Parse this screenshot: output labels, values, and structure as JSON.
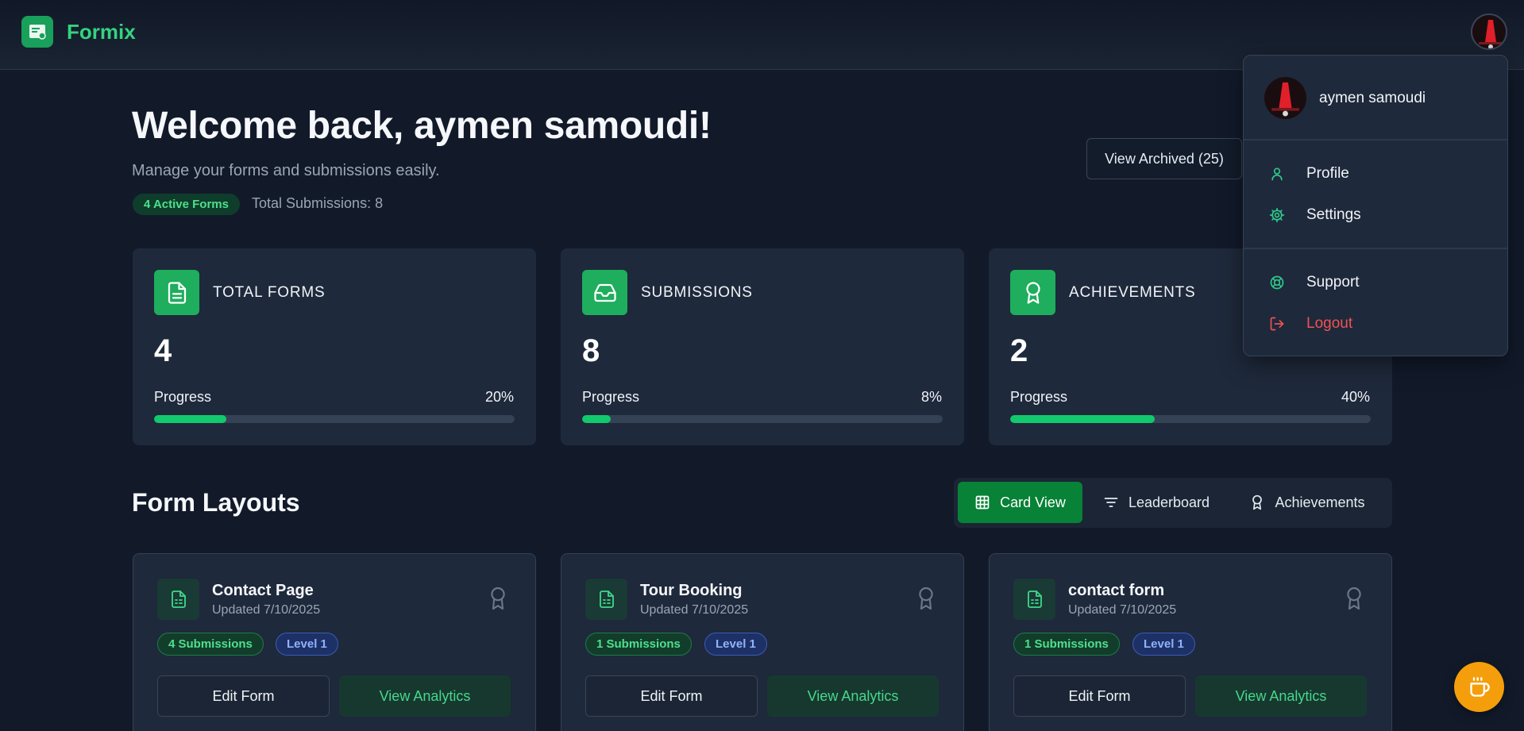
{
  "app": {
    "name": "Formix"
  },
  "user": {
    "name": "aymen samoudi"
  },
  "hero": {
    "welcome": "Welcome back, aymen samoudi!",
    "subtitle": "Manage your forms and submissions easily.",
    "active_badge": "4 Active Forms",
    "total_submissions": "Total Submissions: 8",
    "archived_button": "View Archived (25)"
  },
  "stats": [
    {
      "title": "TOTAL FORMS",
      "value": "4",
      "progress_label": "Progress",
      "progress_pct": "20%",
      "progress": 0.2,
      "icon": "file-text-icon"
    },
    {
      "title": "SUBMISSIONS",
      "value": "8",
      "progress_label": "Progress",
      "progress_pct": "8%",
      "progress": 0.08,
      "icon": "inbox-icon"
    },
    {
      "title": "ACHIEVEMENTS",
      "value": "2",
      "progress_label": "Progress",
      "progress_pct": "40%",
      "progress": 0.4,
      "icon": "award-icon"
    }
  ],
  "section": {
    "title": "Form Layouts"
  },
  "view_toggle": [
    {
      "label": "Card View",
      "icon": "grid-icon",
      "active": true
    },
    {
      "label": "Leaderboard",
      "icon": "filter-icon",
      "active": false
    },
    {
      "label": "Achievements",
      "icon": "award-icon",
      "active": false
    }
  ],
  "forms": [
    {
      "name": "Contact Page",
      "updated": "Updated 7/10/2025",
      "submissions": "4 Submissions",
      "level": "Level 1",
      "edit": "Edit Form",
      "analytics": "View Analytics"
    },
    {
      "name": "Tour Booking",
      "updated": "Updated 7/10/2025",
      "submissions": "1 Submissions",
      "level": "Level 1",
      "edit": "Edit Form",
      "analytics": "View Analytics"
    },
    {
      "name": "contact form",
      "updated": "Updated 7/10/2025",
      "submissions": "1 Submissions",
      "level": "Level 1",
      "edit": "Edit Form",
      "analytics": "View Analytics"
    }
  ],
  "menu": {
    "items": [
      {
        "label": "Profile",
        "icon": "user-icon"
      },
      {
        "label": "Settings",
        "icon": "gear-icon"
      },
      {
        "label": "Support",
        "icon": "lifebuoy-icon"
      },
      {
        "label": "Logout",
        "icon": "logout-icon"
      }
    ]
  },
  "colors": {
    "background": "#121a2a",
    "card": "#1e293b",
    "accent_green": "#12c96d",
    "brand_text": "#34d37f",
    "logout_red": "#f05252",
    "coffee_orange": "#f59e0b"
  },
  "floating": {
    "icon": "coffee-icon"
  }
}
